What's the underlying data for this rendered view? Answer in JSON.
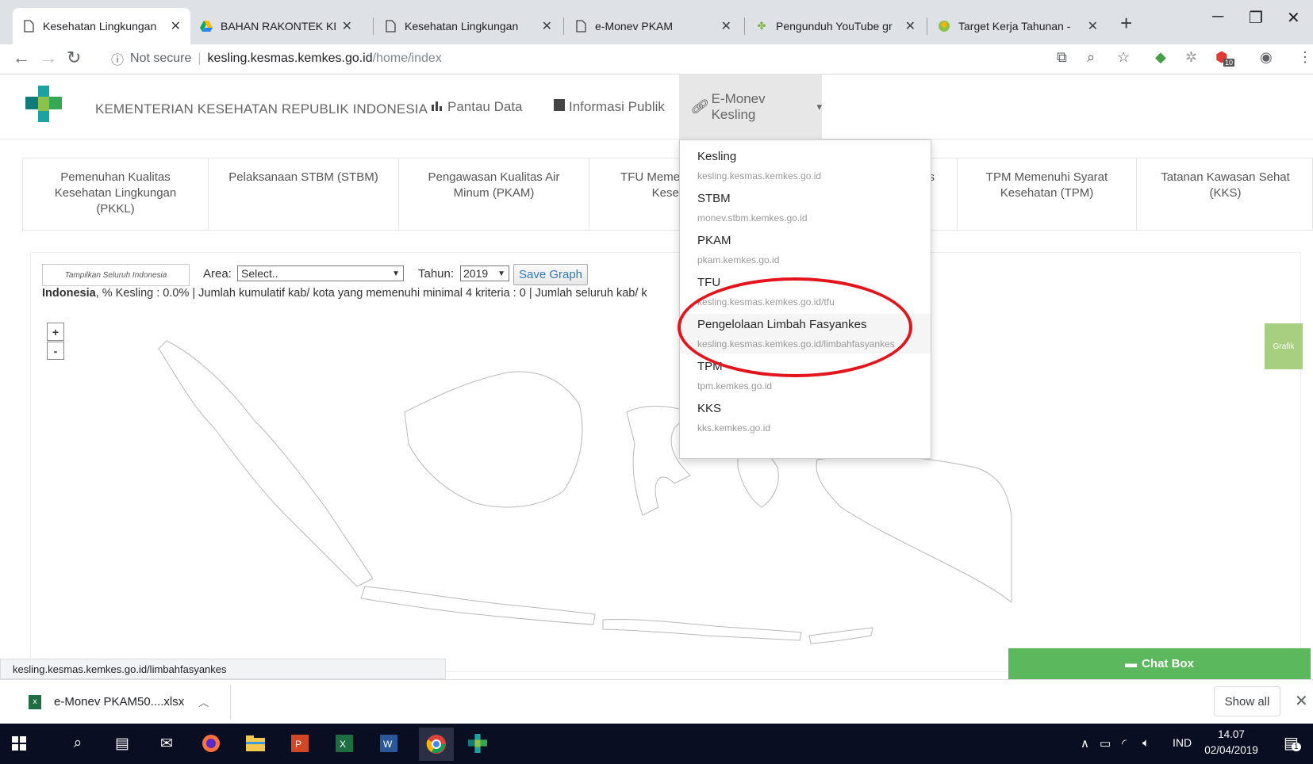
{
  "browser": {
    "tabs": [
      {
        "title": "Kesehatan Lingkungan",
        "icon": "page-icon",
        "active": true
      },
      {
        "title": "BAHAN RAKONTEK KES",
        "icon": "google-drive-icon"
      },
      {
        "title": "Kesehatan Lingkungan",
        "icon": "page-icon"
      },
      {
        "title": "e-Monev PKAM",
        "icon": "page-icon"
      },
      {
        "title": "Pengunduh YouTube gr",
        "icon": "download-leaf-icon"
      },
      {
        "title": "Target Kerja Tahunan - ",
        "icon": "sheet-icon"
      }
    ],
    "security_label": "Not secure",
    "url_host": "kesling.kesmas.kemkes.go.id",
    "url_path": "/home/index",
    "extension_badge": "10"
  },
  "site": {
    "title": "KEMENTERIAN KESEHATAN REPUBLIK INDONESIA",
    "nav": [
      {
        "label": "Pantau Data",
        "icon": "bar-chart-icon"
      },
      {
        "label": "Informasi Publik",
        "icon": "book-icon"
      },
      {
        "label": "E-Monev Kesling",
        "icon": "link-icon",
        "caret": "▾"
      }
    ]
  },
  "dropdown": {
    "items": [
      {
        "title": "Kesling",
        "url": "kesling.kesmas.kemkes.go.id"
      },
      {
        "title": "STBM",
        "url": "monev.stbm.kemkes.go.id"
      },
      {
        "title": "PKAM",
        "url": "pkam.kemkes.go.id"
      },
      {
        "title": "TFU",
        "url": "kesling.kesmas.kemkes.go.id/tfu"
      },
      {
        "title": "Pengelolaan Limbah Fasyankes",
        "url": "kesling.kesmas.kemkes.go.id/limbahfasyankes",
        "highlighted": true
      },
      {
        "title": "TPM",
        "url": "tpm.kemkes.go.id"
      },
      {
        "title": "KKS",
        "url": "kks.kemkes.go.id"
      }
    ],
    "highlight_color": "#e3141b"
  },
  "categories": [
    "Pemenuhan Kualitas Kesehatan Lingkungan (PKKL)",
    "Pelaksanaan STBM (STBM)",
    "Pengawasan Kualitas Air Minum (PKAM)",
    "TFU Memenuhi Syarat Kesehatan",
    "s",
    "TPM Memenuhi Syarat Kesehatan (TPM)",
    "Tatanan Kawasan Sehat (KKS)"
  ],
  "map": {
    "show_all_button": "Tampilkan Seluruh Indonesia",
    "area_label": "Area:",
    "area_value": "Select..",
    "year_label": "Tahun:",
    "year_value": "2019",
    "save_button": "Save Graph",
    "summary_region": "Indonesia",
    "summary_text": ", % Kesling : 0.0% | Jumlah kumulatif kab/ kota yang memenuhi minimal 4 kriteria : 0 | Jumlah seluruh kab/ k",
    "zoom_in": "+",
    "zoom_out": "-",
    "grafik_label": "Grafik",
    "chat_box": "Chat Box"
  },
  "status_url": "kesling.kesmas.kemkes.go.id/limbahfasyankes",
  "downloads": {
    "file": "e-Monev PKAM50....xlsx",
    "show_all": "Show all"
  },
  "taskbar": {
    "language": "IND",
    "time": "14.07",
    "date": "02/04/2019",
    "notification_count": "1"
  },
  "colors": {
    "chat_green": "#5cb85c",
    "grafik_green": "#a6cf7f",
    "link_blue": "#337ab7",
    "taskbar": "#0a0e22"
  }
}
